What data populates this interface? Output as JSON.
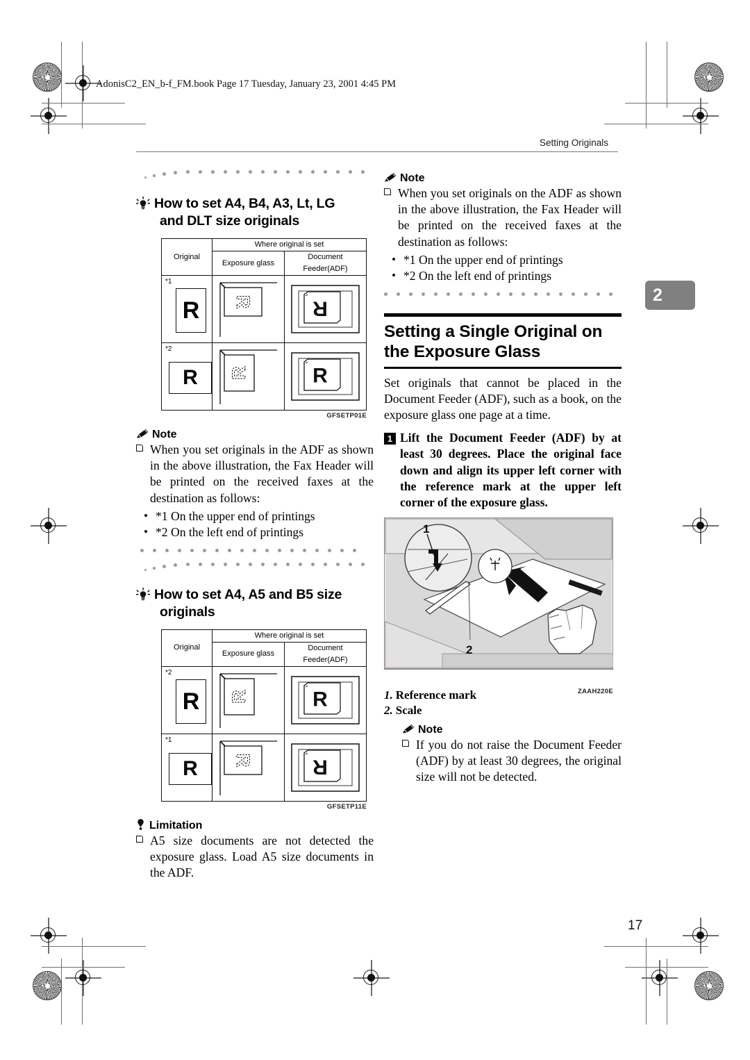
{
  "book_header": "AdonisC2_EN_b-f_FM.book  Page 17  Tuesday, January 23, 2001  4:45 PM",
  "running_head": "Setting Originals",
  "chapter_tab": "2",
  "page_number": "17",
  "left_column": {
    "heading1": {
      "icon": "lightbulb-icon",
      "line1": "How to set A4, B4, A3, Lt, LG",
      "line2": "and DLT size originals"
    },
    "table1": {
      "col_original": "Original",
      "col_group": "Where original is set",
      "col_glass": "Exposure glass",
      "col_adf": "Document Feeder(ADF)",
      "rows": [
        {
          "label": "*1",
          "orientation": "portrait",
          "letter": "R"
        },
        {
          "label": "*2",
          "orientation": "landscape",
          "letter": "R"
        }
      ],
      "figure_code": "GFSETP01E"
    },
    "note": {
      "title": "Note",
      "body": "When you set originals in the ADF as shown in the above illustration, the Fax Header will be printed on the received faxes at the destination as follows:",
      "items": [
        "*1 On the upper end of printings",
        "*2 On the left end of printings"
      ]
    },
    "heading2": {
      "icon": "lightbulb-icon",
      "line1": "How to set A4, A5 and B5 size",
      "line2": "originals"
    },
    "table2": {
      "col_original": "Original",
      "col_group": "Where original is set",
      "col_glass": "Exposure glass",
      "col_adf": "Document Feeder(ADF)",
      "rows": [
        {
          "label": "*2",
          "orientation": "portrait",
          "letter": "R"
        },
        {
          "label": "*1",
          "orientation": "landscape",
          "letter": "R"
        }
      ],
      "figure_code": "GFSETP11E"
    },
    "limitation": {
      "title": "Limitation",
      "body": "A5 size documents are not detected the exposure glass. Load A5 size documents in the ADF."
    }
  },
  "right_column": {
    "note_top": {
      "title": "Note",
      "body": "When you set originals on the ADF as shown in the above illustration, the Fax Header will be printed on the received faxes at the destination as follows:",
      "items": [
        "*1 On the upper end of printings",
        "*2 On the left end of printings"
      ]
    },
    "section": {
      "title_line1": "Setting a Single Original on",
      "title_line2": "the Exposure Glass",
      "intro": "Set originals that cannot be placed in the Document Feeder (ADF), such as a book, on the exposure glass one page at a time.",
      "step1_number": "1",
      "step1_text": "Lift the Document Feeder (ADF) by at least 30 degrees. Place the original face down and align its upper left corner with the reference mark at the upper left corner of the exposure glass."
    },
    "illustration": {
      "callout1": "1",
      "callout2": "2",
      "figure_code": "ZAAH220E"
    },
    "legend": [
      {
        "num": "1.",
        "label": "Reference mark"
      },
      {
        "num": "2.",
        "label": "Scale"
      }
    ],
    "note_bottom": {
      "title": "Note",
      "body": "If you do not raise the Document Feeder (ADF) by at least 30 degrees, the original size will not be detected."
    }
  },
  "colors": {
    "tab_gray": "#808080",
    "rule_black": "#000000",
    "dot_gray": "#9a9a9a",
    "illus_gray": "#d9d9d9"
  }
}
